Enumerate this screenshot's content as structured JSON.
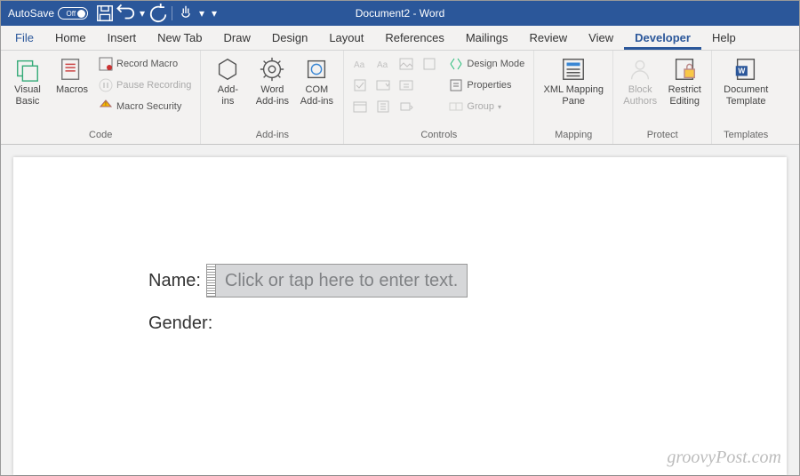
{
  "titlebar": {
    "autosave_label": "AutoSave",
    "autosave_state": "Off",
    "title": "Document2  -  Word"
  },
  "tabs": {
    "file": "File",
    "home": "Home",
    "insert": "Insert",
    "newtab": "New Tab",
    "draw": "Draw",
    "design": "Design",
    "layout": "Layout",
    "references": "References",
    "mailings": "Mailings",
    "review": "Review",
    "view": "View",
    "developer": "Developer",
    "help": "Help"
  },
  "ribbon": {
    "code": {
      "visual_basic": "Visual\nBasic",
      "macros": "Macros",
      "record_macro": "Record Macro",
      "pause_recording": "Pause Recording",
      "macro_security": "Macro Security",
      "label": "Code"
    },
    "addins": {
      "addins": "Add-\nins",
      "word_addins": "Word\nAdd-ins",
      "com_addins": "COM\nAdd-ins",
      "label": "Add-ins"
    },
    "controls": {
      "design_mode": "Design Mode",
      "properties": "Properties",
      "group": "Group",
      "label": "Controls"
    },
    "mapping": {
      "xml_mapping": "XML Mapping\nPane",
      "label": "Mapping"
    },
    "protect": {
      "block_authors": "Block\nAuthors",
      "restrict_editing": "Restrict\nEditing",
      "label": "Protect"
    },
    "templates": {
      "document_template": "Document\nTemplate",
      "label": "Templates"
    }
  },
  "document": {
    "name_label": "Name:",
    "name_placeholder": "Click or tap here to enter text.",
    "gender_label": "Gender:"
  },
  "watermark": "groovyPost.com"
}
